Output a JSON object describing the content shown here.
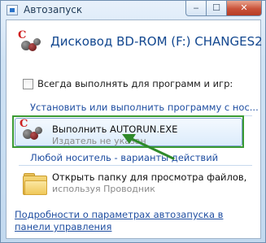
{
  "window": {
    "title": "Автозапуск",
    "minimize_glyph": "‒",
    "maximize_glyph": "☐",
    "close_glyph": "✕"
  },
  "drive": {
    "title": "Дисковод BD-ROM (F:) CHANGES2",
    "icon": "autorun-app-icon"
  },
  "always_checkbox": {
    "label": "Всегда выполнять для программ и игр:",
    "checked": false
  },
  "sections": {
    "install_header": "Установить или выполнить программу с нос...",
    "general_header": "Любой носитель - варианты действий"
  },
  "run_option": {
    "title": "Выполнить AUTORUN.EXE",
    "subtitle": "Издатель не указан",
    "icon": "autorun-app-icon"
  },
  "folder_option": {
    "title": "Открыть папку для просмотра файлов,",
    "subtitle": "используя Проводник",
    "icon": "folder-icon"
  },
  "footer": {
    "link": "Подробности о параметрах автозапуска в панели управления"
  },
  "colors": {
    "highlight_border": "#3a9a33",
    "arrow": "#2f8a2a",
    "link": "#1f4ea1"
  }
}
